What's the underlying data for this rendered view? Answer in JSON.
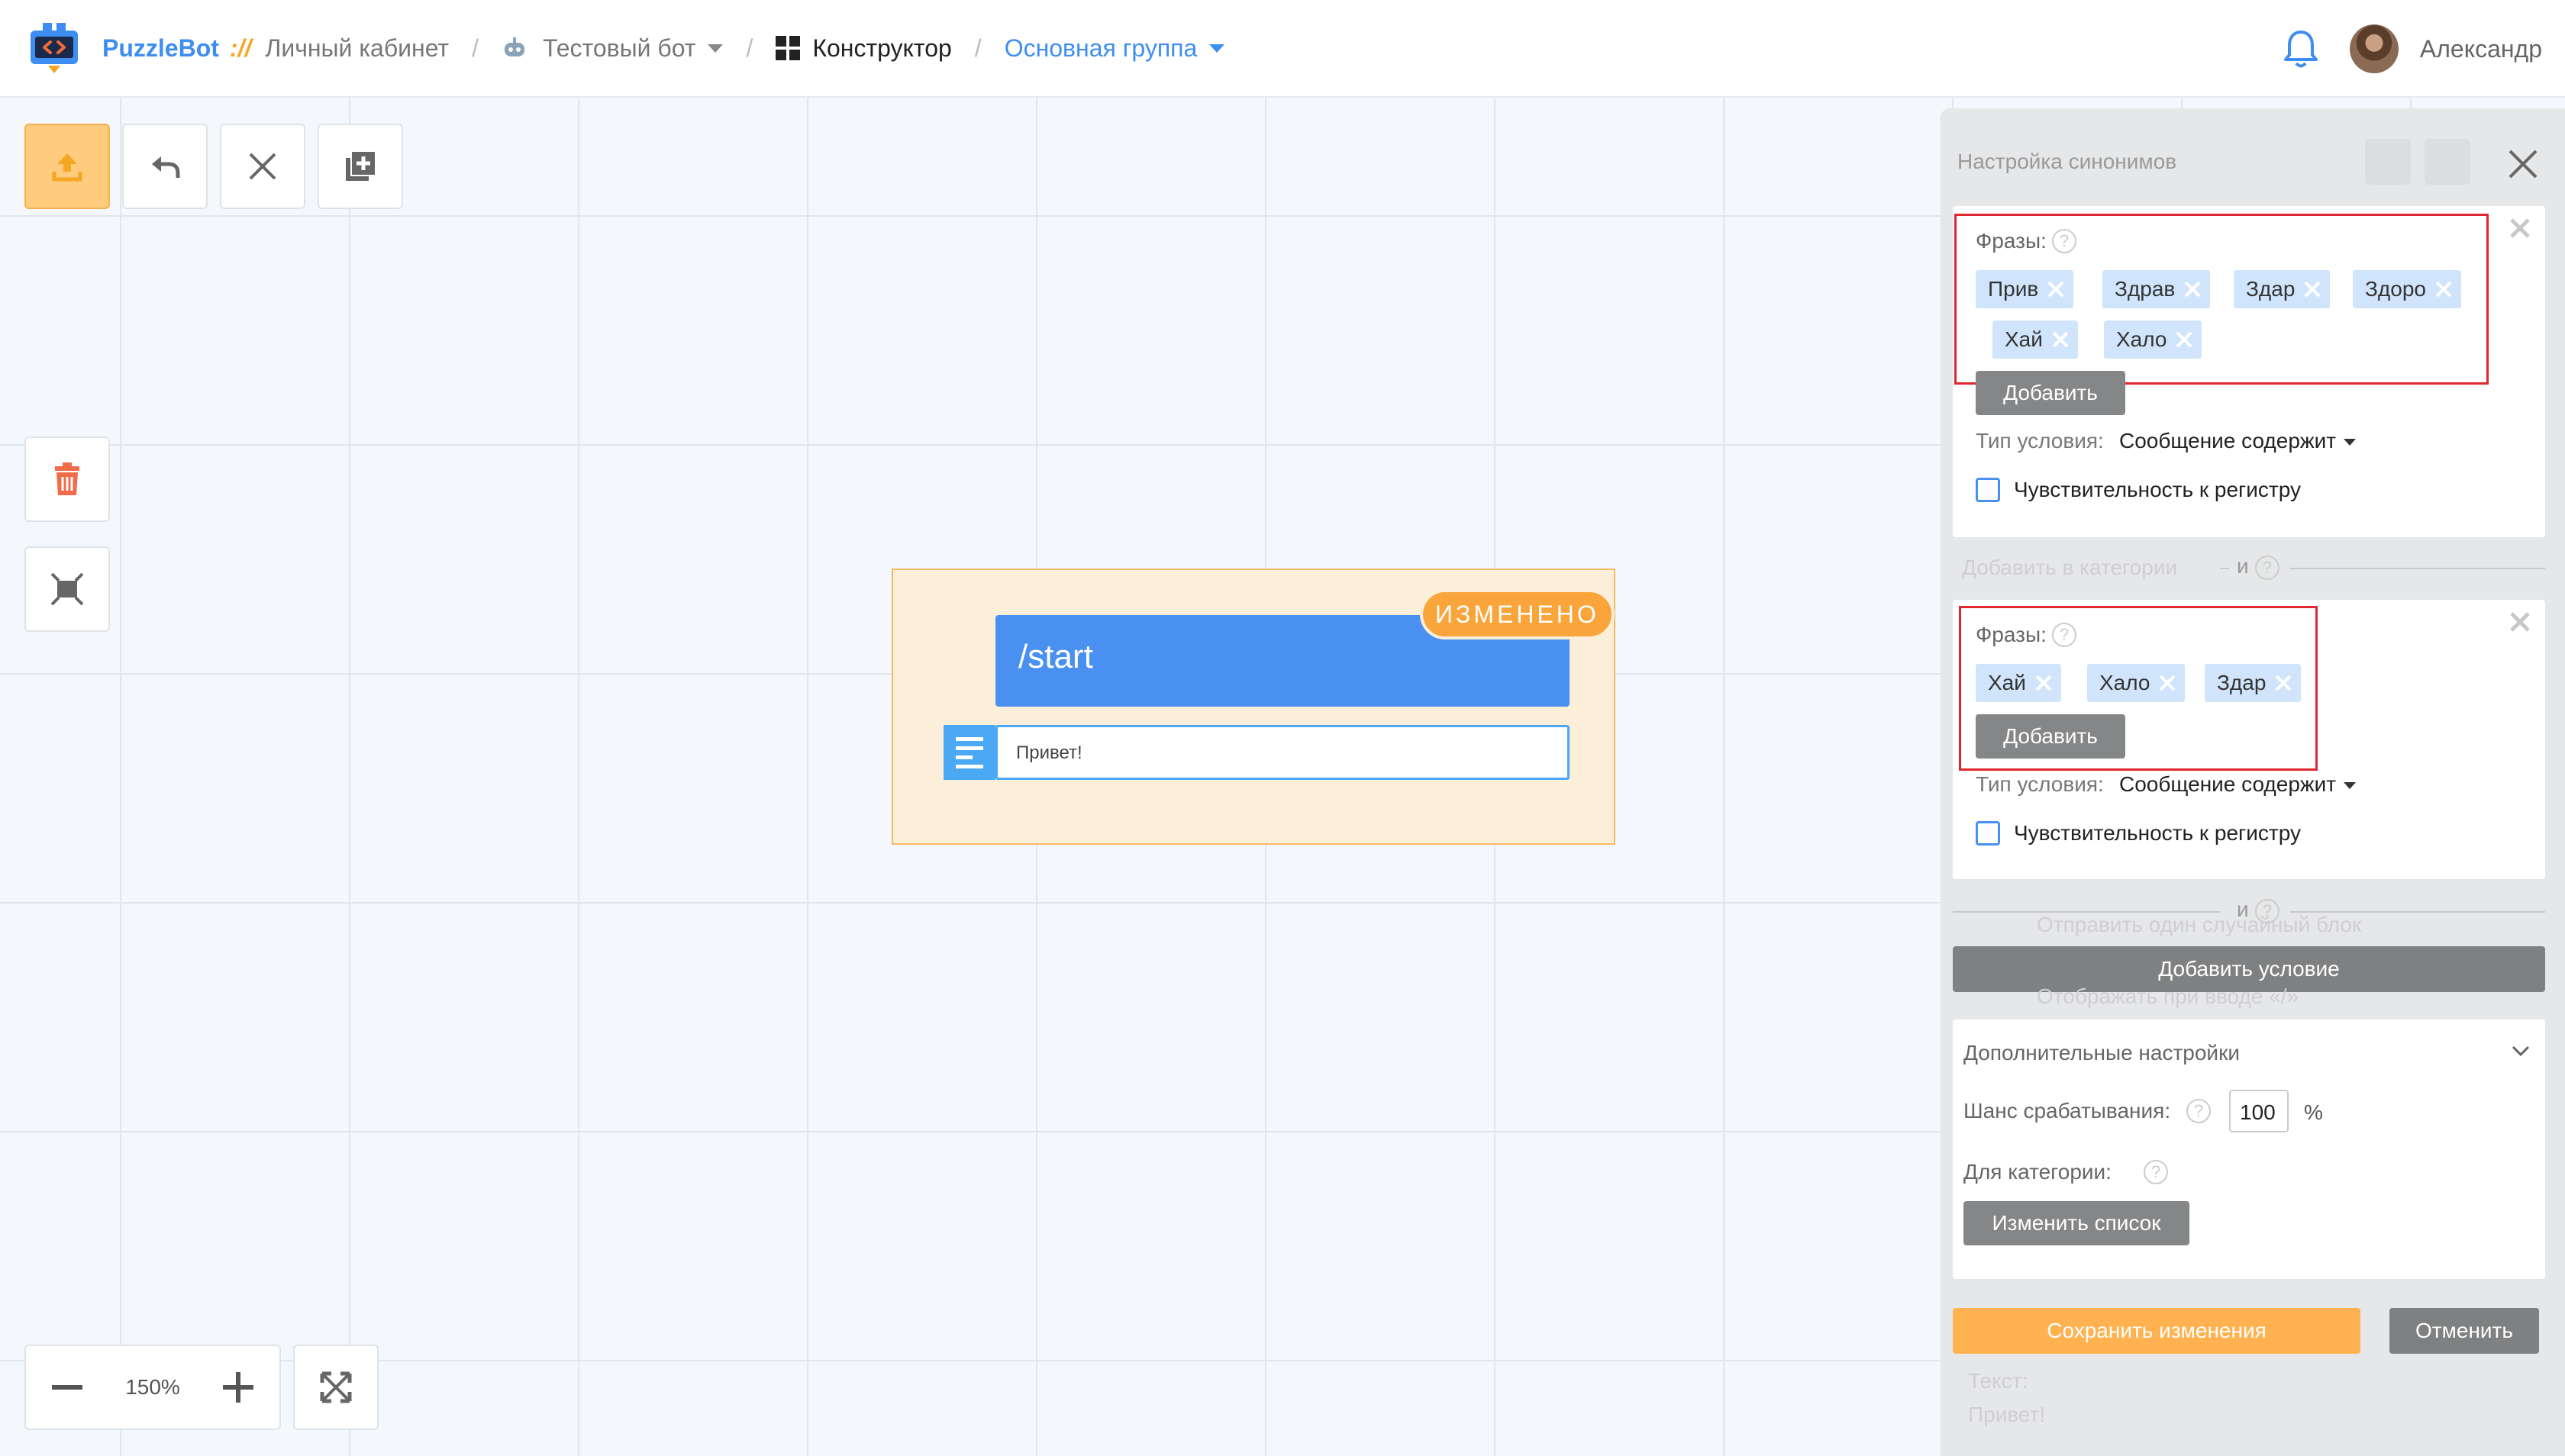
{
  "header": {
    "brand": "PuzzleBot",
    "brand_sep": "://",
    "cabinet": "Личный кабинет",
    "bot_name": "Тестовый бот",
    "section": "Конструктор",
    "group": "Основная группа",
    "user": "Александр"
  },
  "toolbar": {
    "upload_icon": "upload-icon",
    "undo_icon": "undo-icon",
    "close_icon": "close-icon",
    "add_icon": "add-block-icon",
    "delete_icon": "trash-icon",
    "frame_icon": "frame-icon"
  },
  "zoom": {
    "value": "150%"
  },
  "block": {
    "command": "/start",
    "badge": "ИЗМЕНЕНО",
    "message": "Привет!"
  },
  "panel": {
    "title": "Настройка синонимов",
    "condition1": {
      "phrases_label": "Фразы:",
      "tags": [
        "Прив",
        "Здрав",
        "Здар",
        "Здоро",
        "Хай",
        "Хало"
      ],
      "add_label": "Добавить",
      "cond_type_label": "Тип условия:",
      "cond_type_value": "Сообщение содержит",
      "case_label": "Чувствительность к регистру",
      "case_checked": false
    },
    "and1": {
      "faded": "Добавить в категории",
      "and_label": "и"
    },
    "condition2": {
      "phrases_label": "Фразы:",
      "tags": [
        "Хай",
        "Хало",
        "Здар"
      ],
      "add_label": "Добавить",
      "cond_type_label": "Тип условия:",
      "cond_type_value": "Сообщение содержит",
      "case_label": "Чувствительность к регистру",
      "case_checked": false
    },
    "and2": {
      "and_label": "и",
      "faded_top": "Отправить один случайный блок",
      "faded_bottom": "Отображать при вводе «/»"
    },
    "add_condition": "Добавить условие",
    "extra": {
      "title": "Дополнительные настройки",
      "chance_label": "Шанс срабатывания:",
      "chance_value": "100",
      "chance_unit": "%",
      "category_label": "Для категории:",
      "change_list": "Изменить список"
    },
    "save": "Сохранить изменения",
    "cancel": "Отменить",
    "faded_text_label": "Текст:",
    "faded_text_value": "Привет!"
  }
}
